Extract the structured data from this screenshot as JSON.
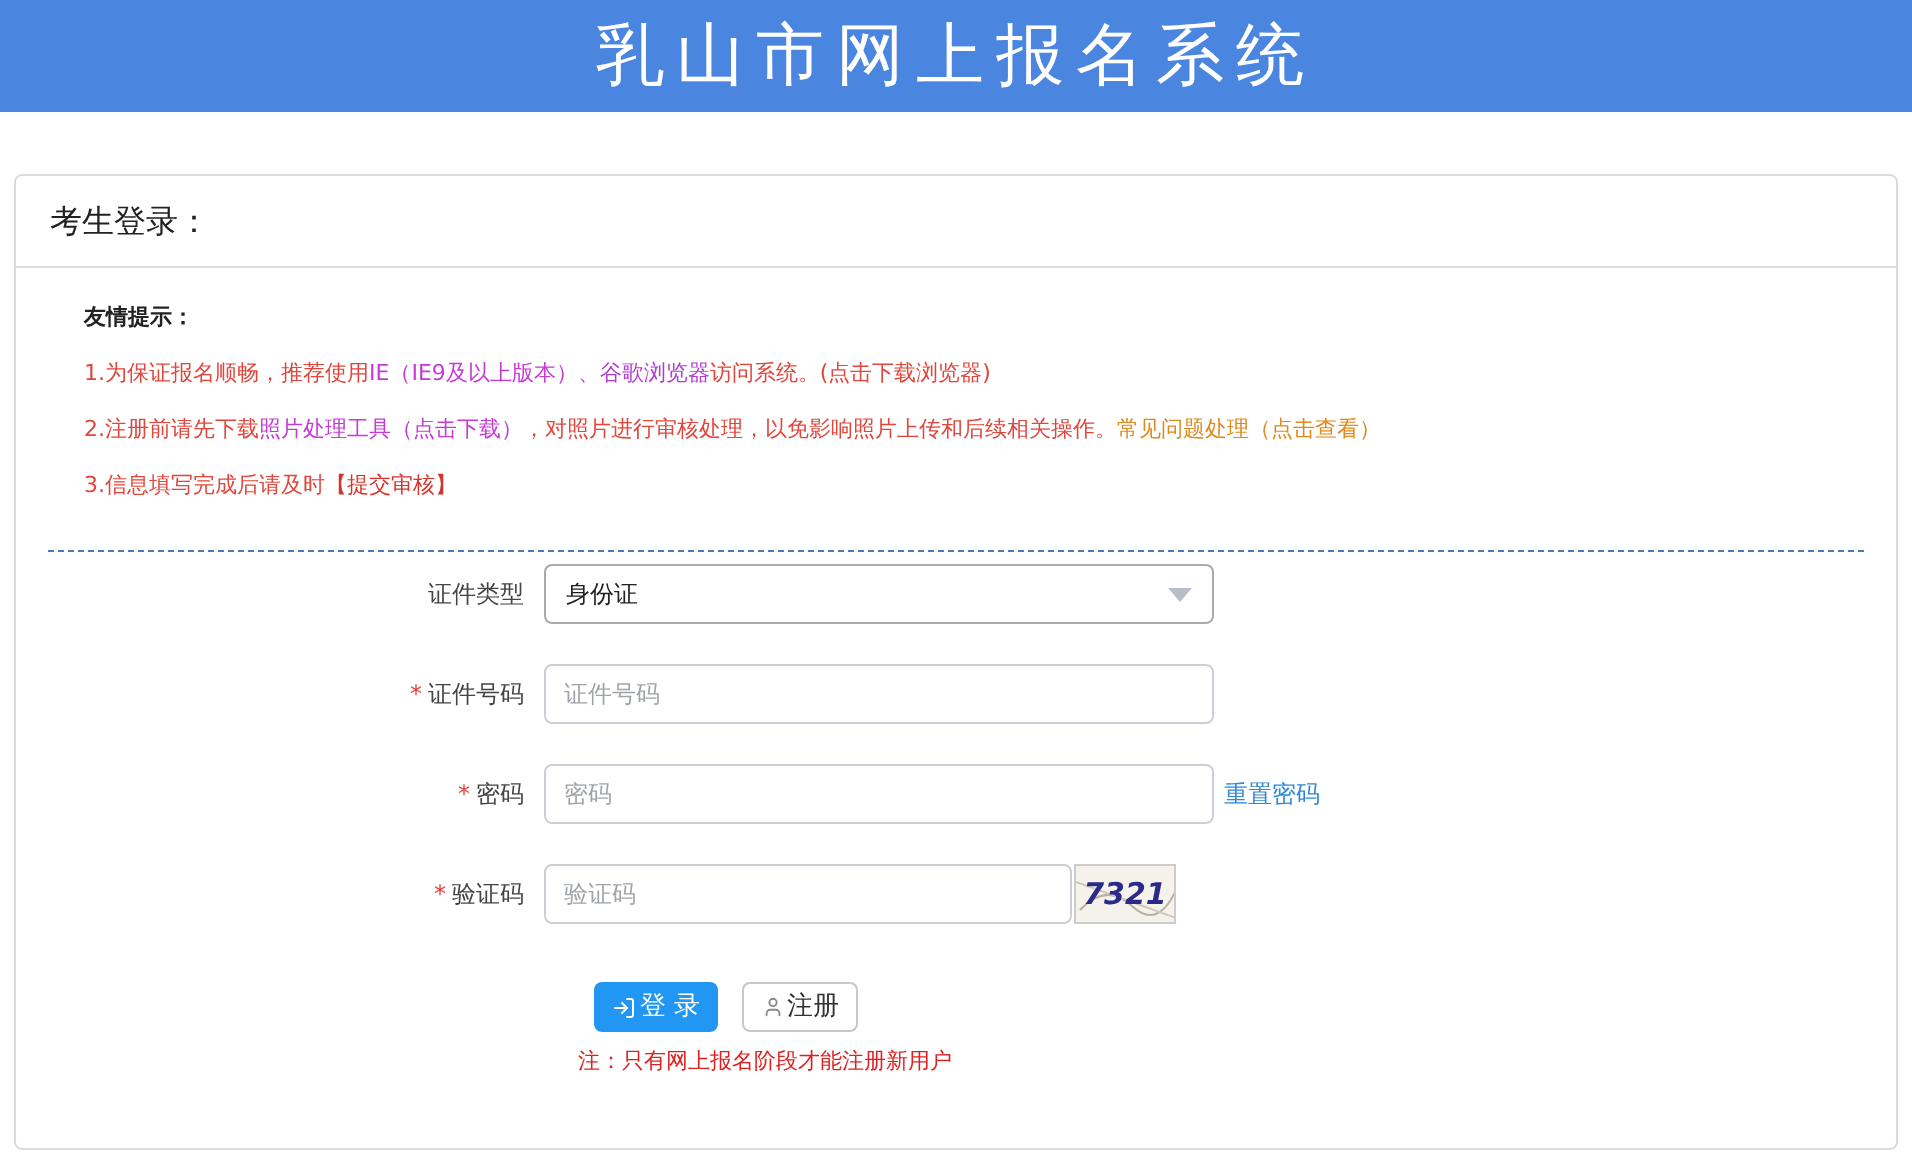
{
  "header": {
    "title": "乳山市网上报名系统"
  },
  "panel": {
    "title": "考生登录："
  },
  "tips": {
    "title": "友情提示：",
    "lines": [
      [
        {
          "text": "1.为保证报名顺畅，推荐使用",
          "color": "#e0463c"
        },
        {
          "text": "IE（IE9及以上版本）、",
          "color": "#c63bd6"
        },
        {
          "text": "谷歌浏览器",
          "color": "#b03cd0"
        },
        {
          "text": "访问系统。(点击下载浏览器)",
          "color": "#e0463c"
        }
      ],
      [
        {
          "text": "2.注册前请先下载",
          "color": "#e0463c"
        },
        {
          "text": "照片处理工具（点击下载）",
          "color": "#c63bd6"
        },
        {
          "text": "，对照片进行审核处理，以免影响照片上传和后续相关操作。",
          "color": "#e0463c"
        },
        {
          "text": "常见问题处理（点击查看）",
          "color": "#e08a1e"
        }
      ],
      [
        {
          "text": "3.信息填写完成后请及时",
          "color": "#e0463c"
        },
        {
          "text": "【提交审核】",
          "color": "#d8322c"
        }
      ]
    ]
  },
  "form": {
    "fields": [
      {
        "kind": "select",
        "label": "证件类型",
        "required": false,
        "value": "身份证"
      },
      {
        "kind": "input",
        "label": "证件号码",
        "required": true,
        "placeholder": "证件号码"
      },
      {
        "kind": "input",
        "label": "密码",
        "required": true,
        "placeholder": "密码",
        "link": "重置密码"
      },
      {
        "kind": "captcha",
        "label": "验证码",
        "required": true,
        "placeholder": "验证码",
        "captcha": "7321"
      }
    ],
    "required_mark": "*",
    "buttons": [
      {
        "kind": "primary",
        "label": "登 录"
      },
      {
        "kind": "secondary",
        "label": "注册"
      }
    ],
    "note": "注：只有网上报名阶段才能注册新用户"
  }
}
